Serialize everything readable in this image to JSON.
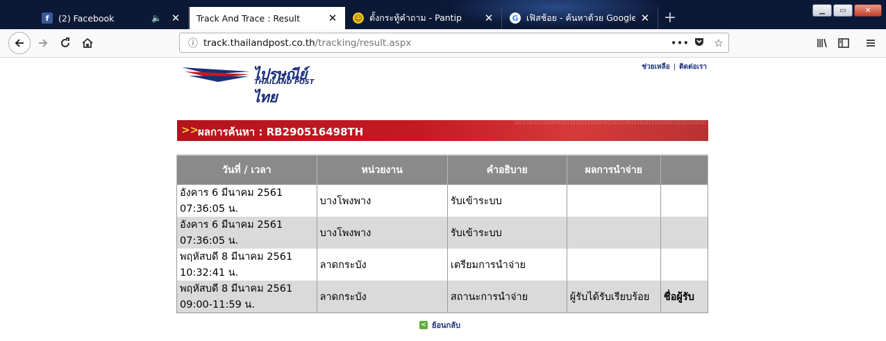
{
  "browser": {
    "tabs": [
      {
        "title": "(2) Facebook",
        "favicon": "facebook-icon",
        "active": false,
        "audio": true
      },
      {
        "title": "Track And Trace : Result",
        "favicon": "",
        "active": true
      },
      {
        "title": "ตั้งกระทู้คำถาม - Pantip",
        "favicon": "pantip-icon",
        "active": false
      },
      {
        "title": "เฟิสช้อย - ค้นหาด้วย Google",
        "favicon": "google-icon",
        "active": false
      }
    ],
    "url_host": "track.thailandpost.co.th",
    "url_path": "/tracking/result.aspx"
  },
  "site": {
    "logo_thai": "ไปรษณีย์ไทย",
    "logo_eng": "THAILAND POST",
    "help_link": "ช่วยเหลือ",
    "contact_link": "ติดต่อเรา",
    "divider": "|"
  },
  "banner": {
    "arrows": ">>",
    "text": "ผลการค้นหา : RB290516498TH"
  },
  "table": {
    "headers": [
      "วันที่ / เวลา",
      "หน่วยงาน",
      "คำอธิบาย",
      "ผลการนำจ่าย",
      ""
    ],
    "rows": [
      {
        "date": "อังคาร 6 มีนาคม 2561",
        "time": "07:36:05 น.",
        "office": "บางโพงพาง",
        "desc": "รับเข้าระบบ",
        "result": "",
        "link": ""
      },
      {
        "date": "อังคาร 6 มีนาคม 2561",
        "time": "07:36:05 น.",
        "office": "บางโพงพาง",
        "desc": "รับเข้าระบบ",
        "result": "",
        "link": ""
      },
      {
        "date": "พฤหัสบดี 8 มีนาคม 2561",
        "time": "10:32:41 น.",
        "office": "ลาดกระบัง",
        "desc": "เตรียมการนำจ่าย",
        "result": "",
        "link": ""
      },
      {
        "date": "พฤหัสบดี 8 มีนาคม 2561",
        "time": "09:00-11:59 น.",
        "office": "ลาดกระบัง",
        "desc": "สถานะการนำจ่าย",
        "result": "ผู้รับได้รับเรียบร้อย",
        "link": "ชื่อผู้รับ"
      }
    ]
  },
  "back_link": "ย้อนกลับ",
  "colors": {
    "tabstrip": "#0b1836",
    "banner_red": "#c31a22",
    "table_header": "#8a8a8a",
    "row_alt": "#dadada",
    "link_blue": "#1c2f7a"
  }
}
